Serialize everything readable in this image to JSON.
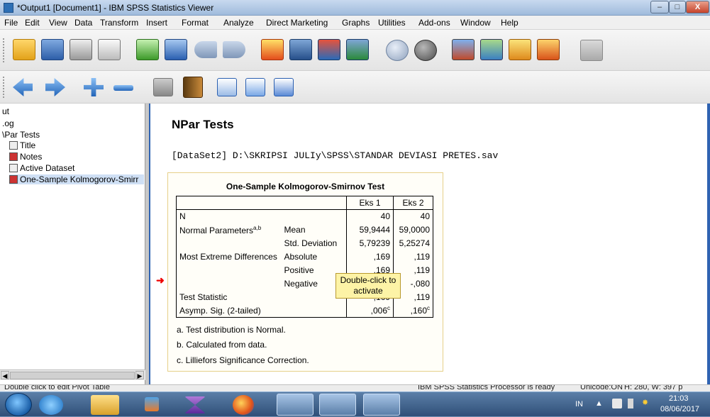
{
  "window": {
    "title": "*Output1 [Document1] - IBM SPSS Statistics Viewer",
    "minimize": "–",
    "maximize": "□",
    "close": "X"
  },
  "menu": [
    "File",
    "Edit",
    "View",
    "Data",
    "Transform",
    "Insert",
    "Format",
    "Analyze",
    "Direct Marketing",
    "Graphs",
    "Utilities",
    "Add-ons",
    "Window",
    "Help"
  ],
  "toolbar1_icons": [
    "open-folder-icon",
    "save-icon",
    "print-icon",
    "print-preview-icon",
    "export-icon",
    "recall-dialog-icon",
    "undo-icon",
    "redo-icon",
    "goto-data-icon",
    "goto-case-icon",
    "variables-icon",
    "select-output-icon",
    "show-all-icon",
    "hide-icon",
    "insert-output-icon",
    "designate-window-icon",
    "edit-icon",
    "script-icon",
    "disabled-icon"
  ],
  "toolbar2_icons": [
    "promote-icon",
    "demote-icon",
    "expand-icon",
    "collapse-icon",
    "show-icon",
    "hide-book-icon",
    "insert-heading-icon",
    "insert-title-icon",
    "insert-text-icon"
  ],
  "outline": [
    {
      "label": "ut",
      "icon": "none"
    },
    {
      "label": ".og",
      "icon": "none"
    },
    {
      "label": "\\Par Tests",
      "icon": "none"
    },
    {
      "label": "Title",
      "icon": "title-icon"
    },
    {
      "label": "Notes",
      "icon": "notes-icon"
    },
    {
      "label": "Active Dataset",
      "icon": "dataset-icon"
    },
    {
      "label": "One-Sample Kolmogorov-Smirr",
      "icon": "table-icon",
      "selected": true
    }
  ],
  "output": {
    "heading": "NPar Tests",
    "dataset_line": "[DataSet2] D:\\SKRIPSI JULIy\\SPSS\\STANDAR DEVIASI PRETES.sav",
    "table_title": "One-Sample Kolmogorov-Smirnov Test",
    "col_headers": [
      "Eks 1",
      "Eks 2"
    ],
    "rows": {
      "n": {
        "label": "N",
        "sub": "",
        "v1": "40",
        "v2": "40"
      },
      "mean": {
        "label": "Normal Parameters",
        "sup": "a,b",
        "sub": "Mean",
        "v1": "59,9444",
        "v2": "59,0000"
      },
      "sd": {
        "label": "",
        "sub": "Std. Deviation",
        "v1": "5,79239",
        "v2": "5,25274"
      },
      "absolute": {
        "label": "Most Extreme Differences",
        "sub": "Absolute",
        "v1": ",169",
        "v2": ",119"
      },
      "positive": {
        "label": "",
        "sub": "Positive",
        "v1": ",169",
        "v2": ",119"
      },
      "negative": {
        "label": "",
        "sub": "Negative",
        "v1": "",
        "v2": "-,080"
      },
      "stat": {
        "label": "Test Statistic",
        "sub": "",
        "v1": ",169",
        "v2": ",119"
      },
      "sig": {
        "label": "Asymp. Sig. (2-tailed)",
        "sub": "",
        "v1": ",006",
        "v1_sup": "c",
        "v2": ",160",
        "v2_sup": "c"
      }
    },
    "footnotes": [
      "a. Test distribution is Normal.",
      "b. Calculated from data.",
      "c. Lilliefors Significance Correction."
    ],
    "tooltip": "Double-click to activate"
  },
  "status": {
    "left": "Double click to edit Pivot Table",
    "processor": "IBM SPSS Statistics Processor is ready",
    "unicode": "Unicode:ON",
    "dims": "H: 280, W: 397 p"
  },
  "taskbar": {
    "lang": "IN",
    "time": "21:03",
    "date": "08/06/2017",
    "apps": [
      "ie-icon",
      "explorer-icon",
      "media-player-icon",
      "visual-studio-icon",
      "firefox-icon",
      "word-icon",
      "spss-icon",
      "excel-icon"
    ]
  },
  "colors": {
    "accent": "#2f63b2",
    "tooltip_bg": "#fdf3a6",
    "frame_border": "#e6d08a",
    "arrow": "#e00000"
  }
}
